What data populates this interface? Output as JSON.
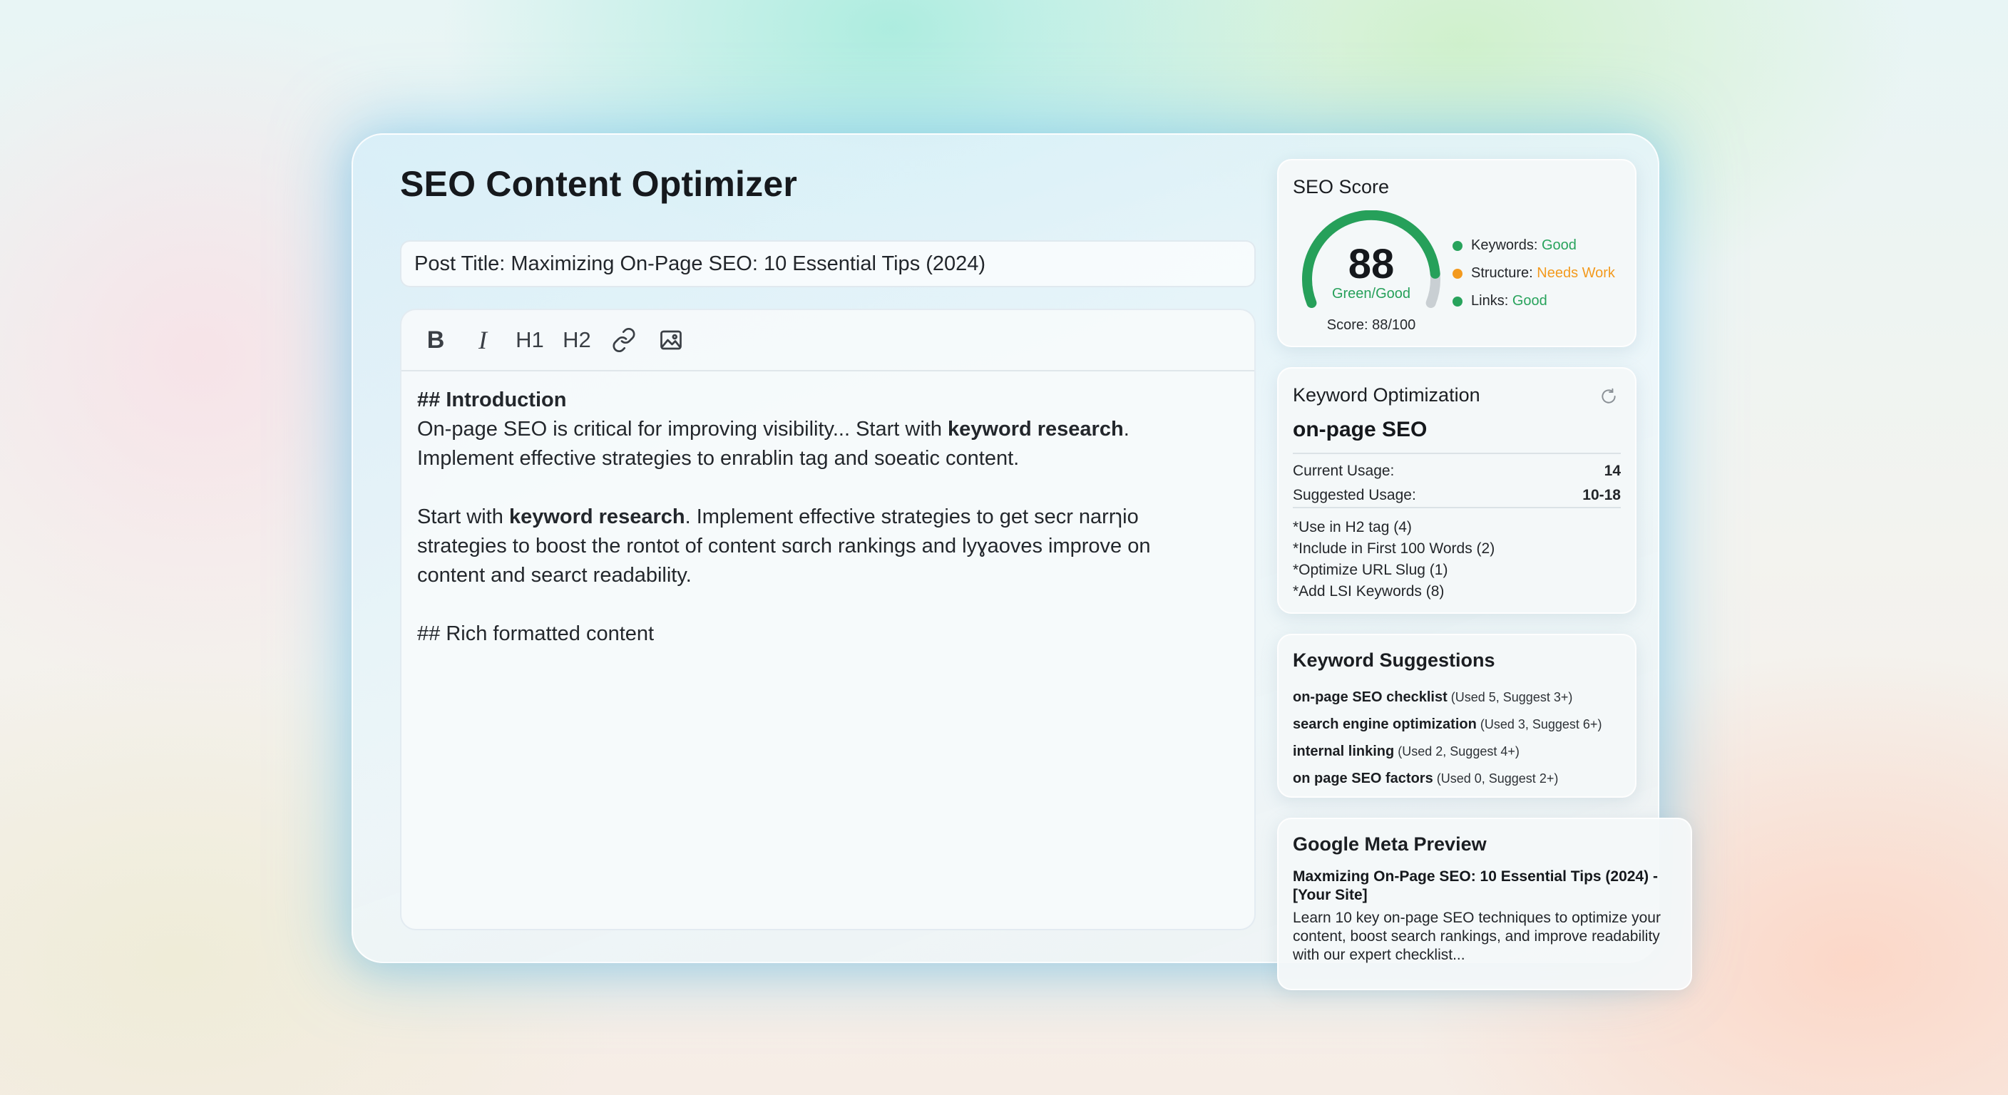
{
  "app": {
    "title": "SEO Content Optimizer"
  },
  "post_title": {
    "label": "Post Title:",
    "value": "Maximizing On-Page SEO: 10 Essential Tips (2024)"
  },
  "toolbar": {
    "bold": "B",
    "italic": "I",
    "h1": "H1",
    "h2": "H2"
  },
  "editor": {
    "heading1": "## Introduction",
    "p1_a": "On-page SEO is critical for improving visibility... Start with ",
    "p1_b": "keyword research",
    "p1_c": ".",
    "p1_line2": "Implement effective strategies to enrablin tag and soeatic content.",
    "p2_a": "Start with ",
    "p2_b": "keyword research",
    "p2_c": ". Implement effective strategies to get secr narrɿio",
    "p2_line2": "strategies to boost the rontot of content sɑrch rankings and lyɣaoves improve on",
    "p2_line3": "content and searct readability.",
    "heading2": "## Rich formatted content"
  },
  "seo_score": {
    "heading": "SEO Score",
    "value": "88",
    "score_fraction": 0.88,
    "status_label": "Green/Good",
    "score_text": "Score: 88/100",
    "metrics": [
      {
        "label": "Keywords:",
        "status": "Good",
        "color": "#28a35c"
      },
      {
        "label": "Structure:",
        "status": "Needs Work",
        "color": "#f39a1e"
      },
      {
        "label": "Links:",
        "status": "Good",
        "color": "#28a35c"
      }
    ],
    "good_color": "#26a05a",
    "track_color": "#c9cfd3"
  },
  "keyword_optimization": {
    "heading": "Keyword Optimization",
    "icon": "refresh-icon",
    "keyword": "on-page SEO",
    "current_label": "Current Usage:",
    "current_value": "14",
    "suggested_label": "Suggested Usage:",
    "suggested_value": "10-18",
    "tips": [
      "*Use in H2 tag (4)",
      "*Include in First 100 Words (2)",
      "*Optimize URL Slug (1)",
      "*Add LSI Keywords (8)"
    ]
  },
  "keyword_suggestions": {
    "heading": "Keyword Suggestions",
    "items": [
      {
        "term": "on-page SEO checklist",
        "meta": "(Used 5, Suggest 3+)"
      },
      {
        "term": "search engine optimization",
        "meta": "(Used 3, Suggest 6+)"
      },
      {
        "term": "internal linking",
        "meta": "(Used 2, Suggest 4+)"
      },
      {
        "term": "on page SEO factors",
        "meta": "(Used 0, Suggest 2+)"
      }
    ]
  },
  "meta_preview": {
    "heading": "Google Meta Preview",
    "title": "Maxmizing On-Page SEO: 10 Essential Tips (2024) - [Your Site]",
    "description": "Learn 10 key on-page SEO techniques to optimize your content, boost search rankings, and improve readability with our expert checklist..."
  }
}
